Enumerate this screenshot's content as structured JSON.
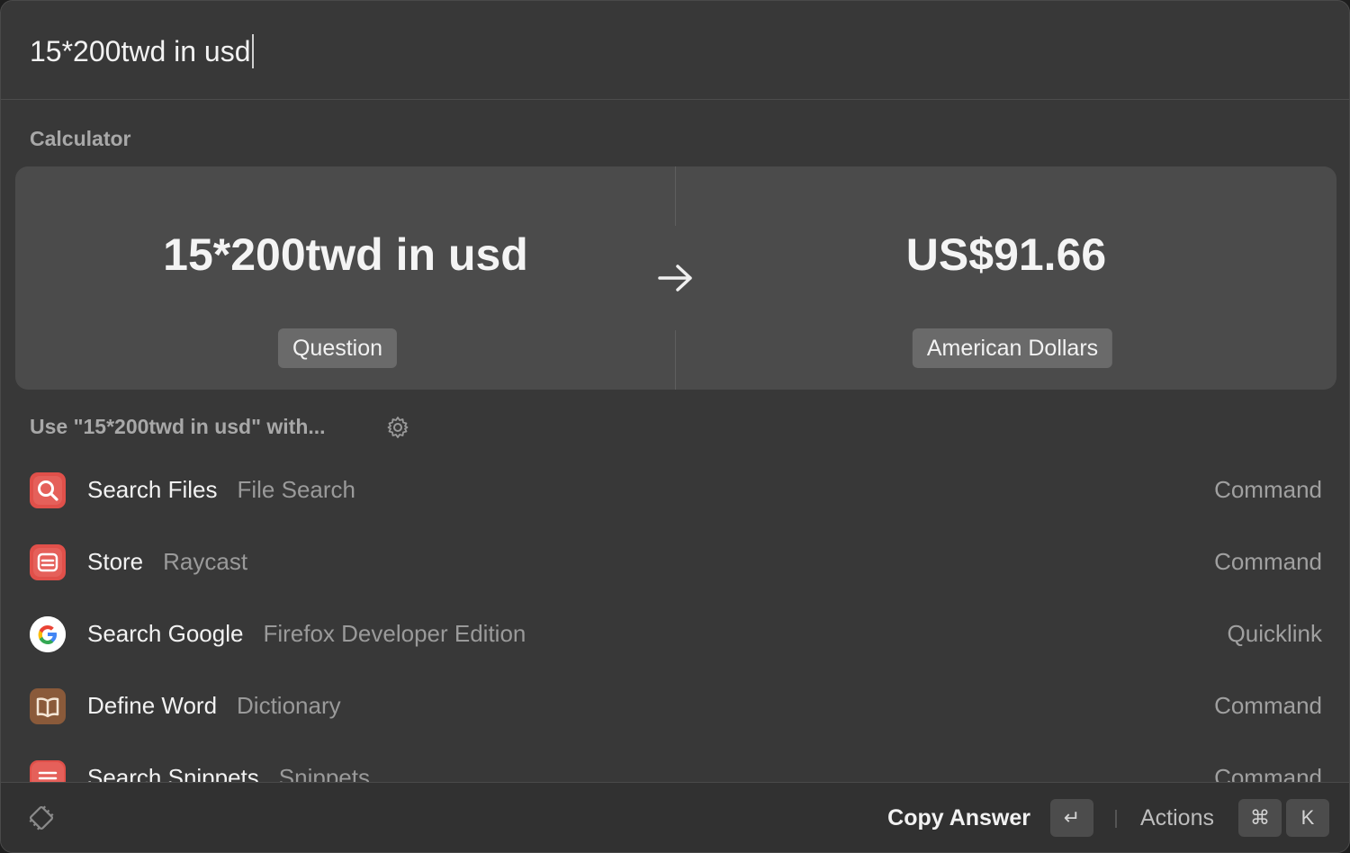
{
  "search": {
    "query": "15*200twd in usd"
  },
  "calculator": {
    "section_title": "Calculator",
    "question": "15*200twd in usd",
    "question_label": "Question",
    "answer": "US$91.66",
    "answer_label": "American Dollars"
  },
  "use_with": {
    "section_title": "Use \"15*200twd in usd\" with..."
  },
  "results": [
    {
      "title": "Search Files",
      "subtitle": "File Search",
      "type": "Command",
      "icon": "magnifier-icon",
      "color": "#e0504a"
    },
    {
      "title": "Store",
      "subtitle": "Raycast",
      "type": "Command",
      "icon": "store-icon",
      "color": "#e0504a"
    },
    {
      "title": "Search Google",
      "subtitle": "Firefox Developer Edition",
      "type": "Quicklink",
      "icon": "google-icon",
      "color": "#ffffff"
    },
    {
      "title": "Define Word",
      "subtitle": "Dictionary",
      "type": "Command",
      "icon": "book-icon",
      "color": "#8a5a3a"
    },
    {
      "title": "Search Snippets",
      "subtitle": "Snippets",
      "type": "Command",
      "icon": "snippets-icon",
      "color": "#e0504a"
    }
  ],
  "footer": {
    "primary_action": "Copy Answer",
    "enter_key": "↵",
    "actions_label": "Actions",
    "cmd_key": "⌘",
    "k_key": "K"
  }
}
